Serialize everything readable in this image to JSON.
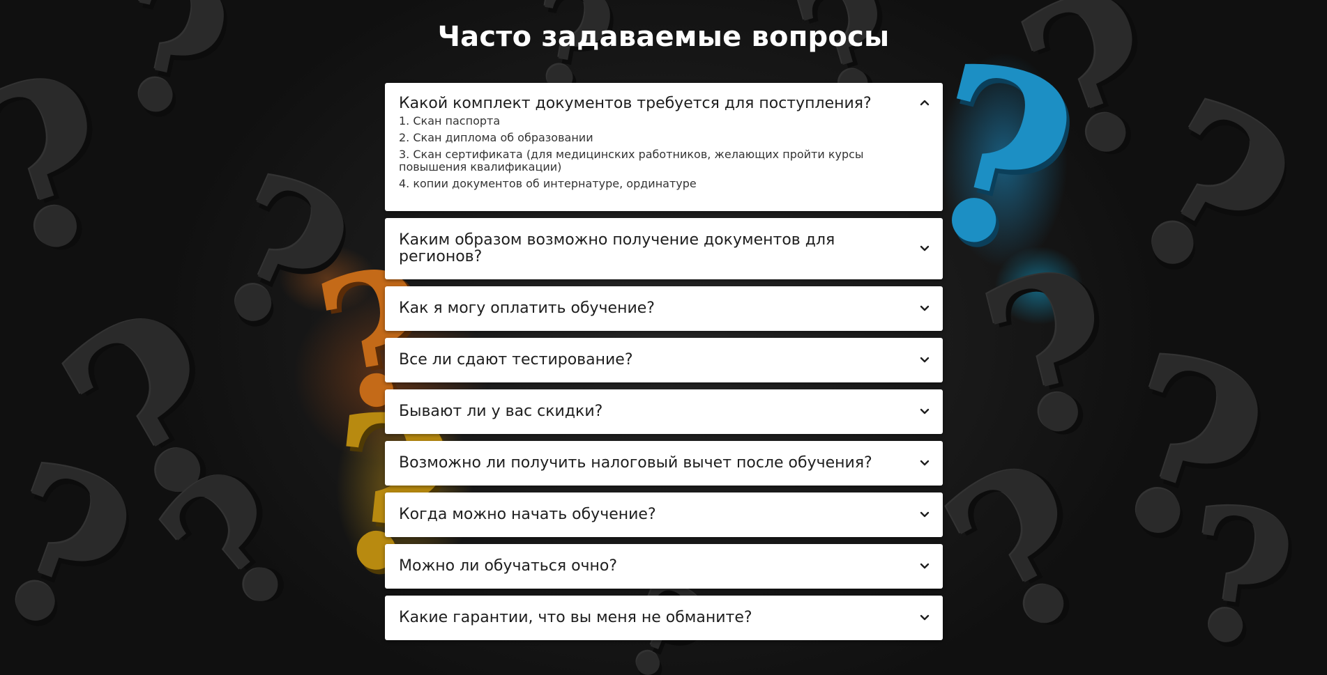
{
  "heading": "Часто задаваемые вопросы",
  "faq": {
    "items": [
      {
        "question": "Какой комплект документов требуется для поступления?",
        "expanded": true,
        "answer": [
          "1. Скан паспорта",
          "2. Скан диплома об образовании",
          "3. Скан сертификата (для медицинских работников, желающих пройти курсы повышения квалификации)",
          "4. копии документов об интернатуре, ординатуре"
        ]
      },
      {
        "question": "Каким образом возможно получение документов для регионов?",
        "expanded": false
      },
      {
        "question": "Как я могу оплатить обучение?",
        "expanded": false
      },
      {
        "question": "Все ли сдают тестирование?",
        "expanded": false
      },
      {
        "question": "Бывают ли у вас скидки?",
        "expanded": false
      },
      {
        "question": "Возможно ли получить налоговый вычет после обучения?",
        "expanded": false
      },
      {
        "question": "Когда можно начать обучение?",
        "expanded": false
      },
      {
        "question": "Можно ли обучаться очно?",
        "expanded": false
      },
      {
        "question": "Какие гарантии, что вы меня не обманите?",
        "expanded": false
      }
    ]
  },
  "icons": {
    "expanded": "chevron-up-icon",
    "collapsed": "chevron-down-icon"
  },
  "colors": {
    "card_background": "#ffffff",
    "heading_text": "#ffffff",
    "question_text": "#1e1e1e",
    "answer_text": "#333333",
    "page_background": "#151515",
    "accent_blue": "#1c8fc4",
    "accent_orange": "#c46a18",
    "accent_gold": "#b88a10"
  }
}
